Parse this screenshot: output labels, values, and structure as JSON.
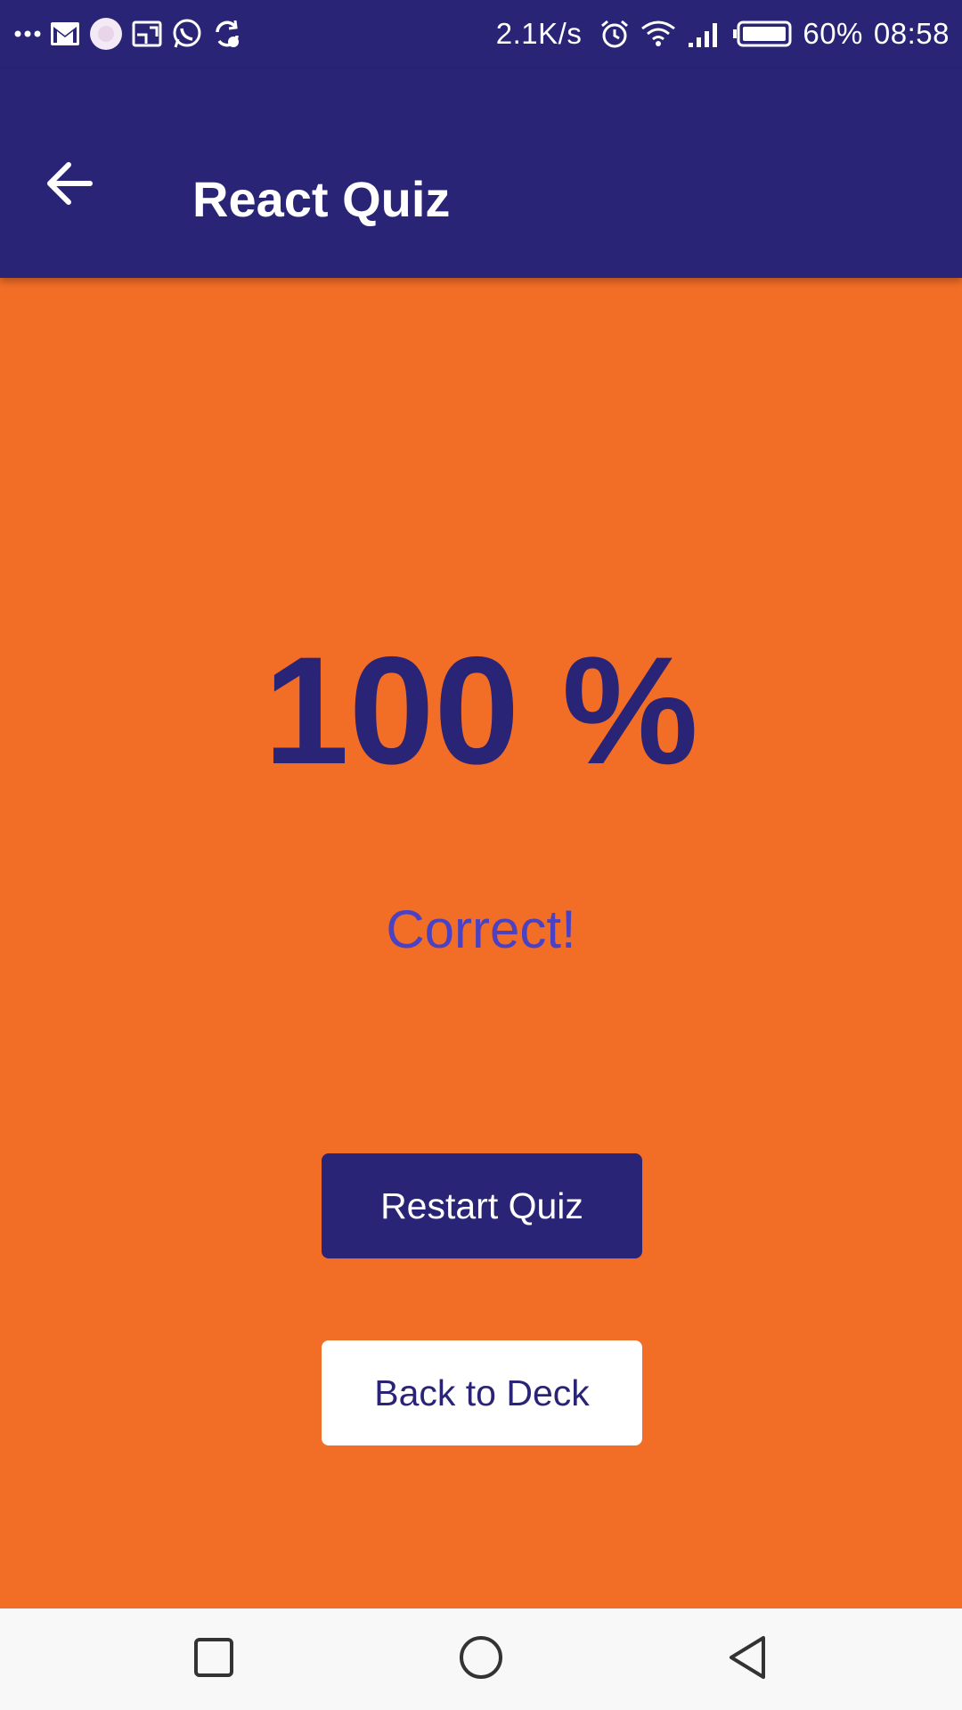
{
  "status_bar": {
    "notification_icons": [
      "more-dots-icon",
      "gmail-icon",
      "app-circle-icon",
      "cast-icon",
      "whatsapp-icon",
      "sync-icon"
    ],
    "network_speed": "2.1K/s",
    "battery_percent": "60%",
    "time": "08:58",
    "system_icons": [
      "alarm-icon",
      "wifi-icon",
      "signal-icon",
      "battery-icon"
    ]
  },
  "app_bar": {
    "back_icon": "arrow-left-icon",
    "title": "React Quiz"
  },
  "result": {
    "score_text": "100 %",
    "label": "Correct!"
  },
  "actions": {
    "restart_label": "Restart Quiz",
    "back_to_deck_label": "Back to Deck"
  },
  "nav_bar": {
    "icons": [
      "recents-square-icon",
      "home-circle-icon",
      "back-triangle-icon"
    ]
  },
  "colors": {
    "primary": "#2a2476",
    "background": "#f26e27",
    "accent_text": "#4a42c2",
    "white": "#ffffff"
  }
}
